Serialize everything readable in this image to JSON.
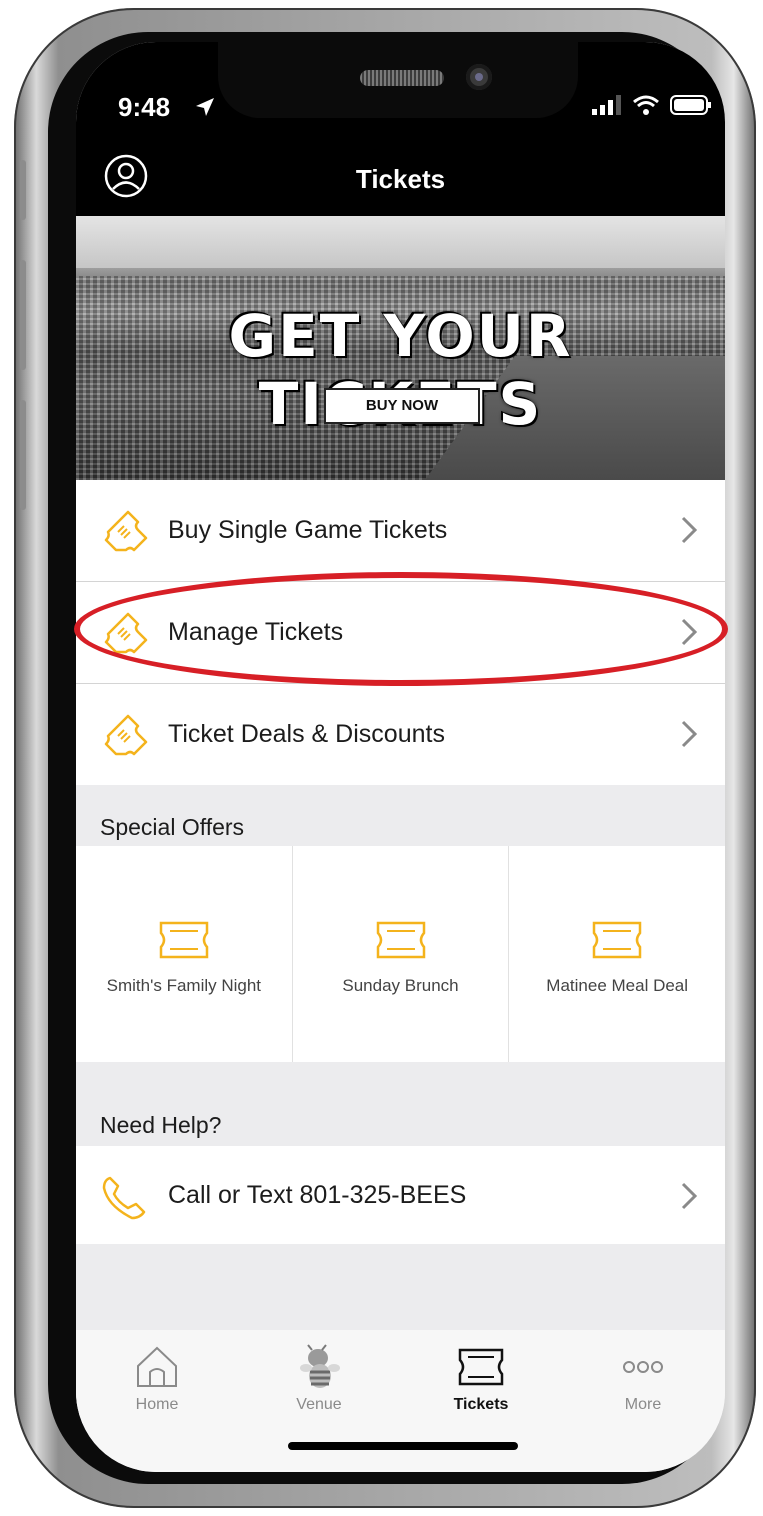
{
  "status_bar": {
    "time": "9:48"
  },
  "header": {
    "title": "Tickets"
  },
  "banner": {
    "headline": "GET YOUR TICKETS",
    "button_label": "BUY NOW"
  },
  "ticket_menu": [
    {
      "label": "Buy Single Game Tickets",
      "icon": "ticket-icon"
    },
    {
      "label": "Manage Tickets",
      "icon": "ticket-icon"
    },
    {
      "label": "Ticket Deals & Discounts",
      "icon": "ticket-icon"
    }
  ],
  "special_offers": {
    "title": "Special Offers",
    "items": [
      {
        "label": "Smith's Family Night",
        "icon": "ticket-icon"
      },
      {
        "label": "Sunday Brunch",
        "icon": "ticket-icon"
      },
      {
        "label": "Matinee Meal Deal",
        "icon": "ticket-icon"
      }
    ]
  },
  "help": {
    "title": "Need Help?",
    "call_label": "Call or Text 801-325-BEES",
    "icon": "phone-icon"
  },
  "tab_bar": {
    "tabs": [
      {
        "label": "Home",
        "icon": "home-icon",
        "active": false
      },
      {
        "label": "Venue",
        "icon": "bee-mascot-icon",
        "active": false
      },
      {
        "label": "Tickets",
        "icon": "ticket-icon",
        "active": true
      },
      {
        "label": "More",
        "icon": "more-dots-icon",
        "active": false
      }
    ]
  },
  "colors": {
    "accent": "#f4b31c",
    "highlight": "#d71f26",
    "header_bg": "#000000"
  }
}
